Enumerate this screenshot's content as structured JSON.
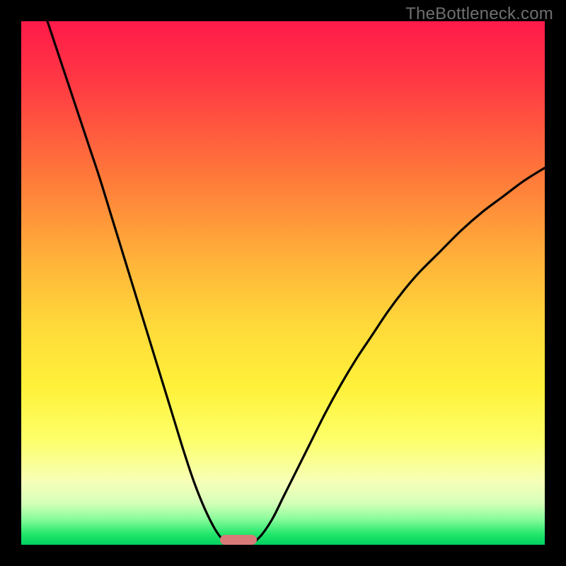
{
  "watermark": "TheBottleneck.com",
  "chart_data": {
    "type": "line",
    "title": "",
    "xlabel": "",
    "ylabel": "",
    "xlim": [
      0,
      100
    ],
    "ylim": [
      0,
      100
    ],
    "series": [
      {
        "name": "left-curve",
        "x": [
          5,
          7,
          9,
          11,
          13,
          15,
          17,
          19,
          21,
          23,
          25,
          27,
          29,
          31,
          33,
          35,
          37,
          38.5,
          40
        ],
        "values": [
          100,
          94,
          88,
          82,
          76,
          70,
          63.5,
          57,
          50.5,
          44,
          37.5,
          31,
          24.5,
          18,
          12,
          7,
          3,
          1,
          0
        ]
      },
      {
        "name": "right-curve",
        "x": [
          44,
          46,
          48,
          50,
          52,
          55,
          58,
          61,
          64,
          67,
          70,
          73,
          76,
          80,
          84,
          88,
          92,
          96,
          100
        ],
        "values": [
          0,
          2,
          5,
          9,
          13,
          19,
          25,
          30.5,
          35.5,
          40,
          44.5,
          48.5,
          52,
          56,
          60,
          63.5,
          66.5,
          69.5,
          72
        ]
      }
    ],
    "marker": {
      "x_start": 38,
      "x_end": 45,
      "color": "#d87a78"
    },
    "gradient_stops": [
      {
        "pos": 0,
        "color": "#ff1a4a"
      },
      {
        "pos": 30,
        "color": "#ff7a3a"
      },
      {
        "pos": 58,
        "color": "#ffd93a"
      },
      {
        "pos": 80,
        "color": "#fdff6a"
      },
      {
        "pos": 95,
        "color": "#8bfc9c"
      },
      {
        "pos": 100,
        "color": "#00d060"
      }
    ]
  }
}
